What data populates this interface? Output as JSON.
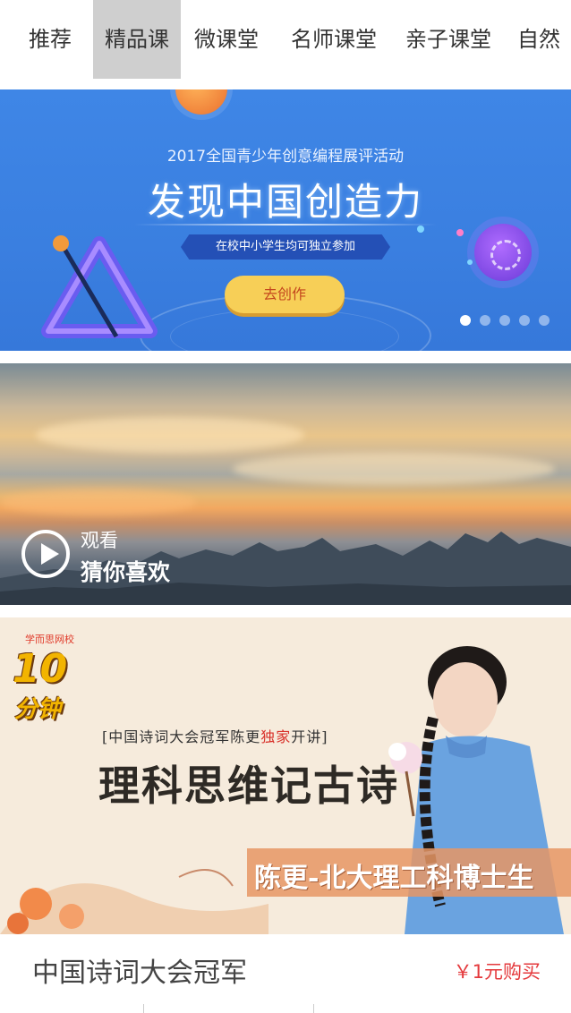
{
  "tabs": [
    {
      "label": "推荐",
      "active": false
    },
    {
      "label": "精品课",
      "active": true
    },
    {
      "label": "微课堂",
      "active": false
    },
    {
      "label": "名师课堂",
      "active": false
    },
    {
      "label": "亲子课堂",
      "active": false
    },
    {
      "label": "自然",
      "active": false
    }
  ],
  "banner": {
    "subtitle": "2017全国青少年创意编程展评活动",
    "title": "发现中国创造力",
    "ribbon": "在校中小学生均可独立参加",
    "cta": "去创作",
    "slide_count": 5,
    "active_slide": 1
  },
  "video": {
    "watch_label": "观看",
    "caption": "猜你喜欢"
  },
  "course": {
    "school": "学而思网校",
    "logo_number": "10",
    "logo_word": "分钟",
    "tag_prefix": "[中国诗词大会冠军陈更",
    "tag_highlight": "独家",
    "tag_suffix": "开讲]",
    "title": "理科思维记古诗",
    "teacher": "陈更-北大理工科博士生",
    "name": "中国诗词大会冠军",
    "price": "￥1元购买"
  },
  "colors": {
    "active_tab_bg": "#cfcfcf",
    "banner_blue": "#3a7fe0",
    "cta_yellow": "#f7cf57",
    "price_red": "#e4393c"
  }
}
